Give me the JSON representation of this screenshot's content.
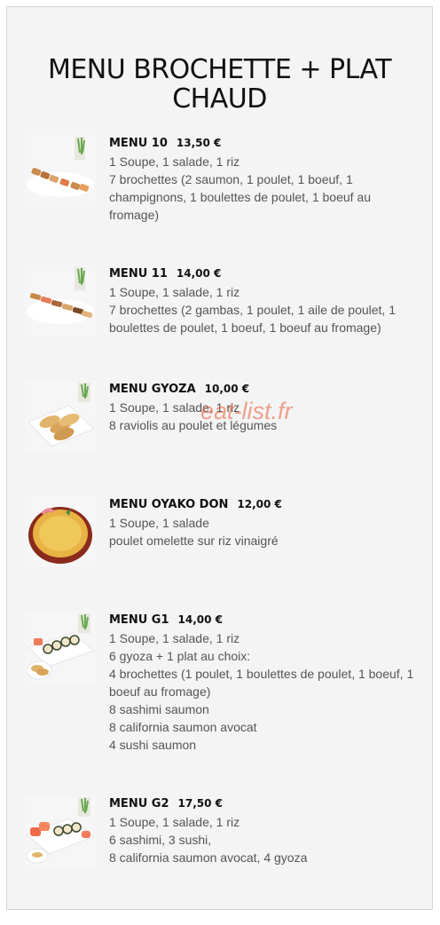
{
  "title": "MENU BROCHETTE + PLAT CHAUD",
  "watermark": "eat-list.fr",
  "menus": [
    {
      "name": "MENU 10",
      "price": "13,50 €",
      "lines": [
        "1 Soupe, 1 salade, 1 riz",
        "7 brochettes (2 saumon, 1 poulet, 1 boeuf, 1 champignons, 1 boulettes de poulet, 1 boeuf au fromage)"
      ]
    },
    {
      "name": "MENU 11",
      "price": "14,00 €",
      "lines": [
        "1 Soupe, 1 salade, 1 riz",
        "7 brochettes (2 gambas, 1 poulet, 1 aile de poulet, 1 boulettes de poulet, 1 boeuf, 1 boeuf au fromage)"
      ]
    },
    {
      "name": "MENU GYOZA",
      "price": "10,00 €",
      "lines": [
        "1 Soupe, 1 salade, 1 riz",
        "8 raviolis au poulet et légumes"
      ]
    },
    {
      "name": "MENU OYAKO DON",
      "price": "12,00 €",
      "lines": [
        "1 Soupe, 1 salade",
        "poulet omelette sur riz vinaigré"
      ]
    },
    {
      "name": "MENU G1",
      "price": "14,00 €",
      "lines": [
        "1 Soupe, 1 salade, 1 riz",
        "6 gyoza + 1 plat au choix:",
        "4 brochettes (1 poulet, 1 boulettes de poulet, 1 boeuf, 1 boeuf au fromage)",
        "8 sashimi saumon",
        "8 california saumon avocat",
        "4 sushi saumon"
      ]
    },
    {
      "name": "MENU G2",
      "price": "17,50 €",
      "lines": [
        "1 Soupe, 1 salade, 1 riz",
        "6 sashimi, 3 sushi,",
        "8 california saumon avocat, 4 gyoza"
      ]
    }
  ]
}
